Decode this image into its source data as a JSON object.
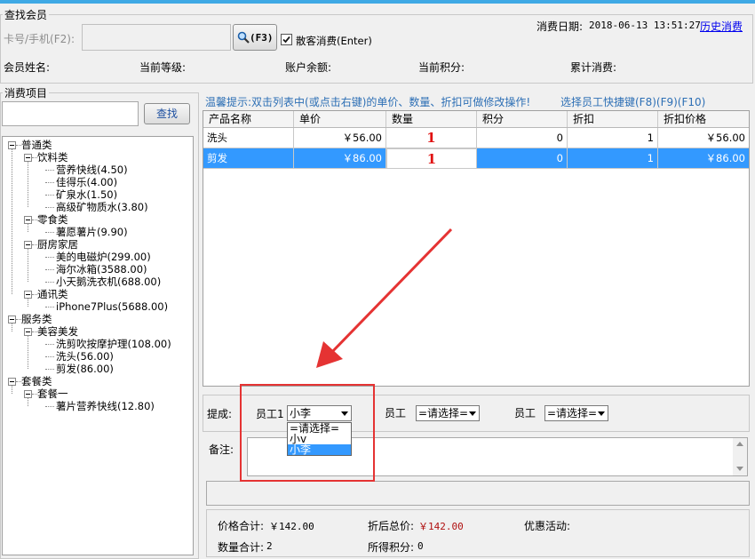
{
  "member_search": {
    "legend": "查找会员",
    "card_label": "卡号/手机(F2):",
    "card_value": "",
    "search_button": "(F3)",
    "walkin_label": "散客消费(Enter)",
    "walkin_checked": true,
    "date_label": "消费日期:",
    "date_value": "2018-06-13 13:51:27",
    "history_link": "历史消费",
    "name_label": "会员姓名:",
    "level_label": "当前等级:",
    "balance_label": "账户余额:",
    "points_label": "当前积分:",
    "total_label": "累计消费:"
  },
  "items_panel": {
    "legend": "消费项目",
    "search_value": "",
    "search_button": "查找"
  },
  "tree": [
    {
      "label": "普通类",
      "level": 0,
      "box": true
    },
    {
      "label": "饮料类",
      "level": 1,
      "box": true
    },
    {
      "label": "营养快线(4.50)",
      "level": 2
    },
    {
      "label": "佳得乐(4.00)",
      "level": 2
    },
    {
      "label": "矿泉水(1.50)",
      "level": 2
    },
    {
      "label": "高级矿物质水(3.80)",
      "level": 2
    },
    {
      "label": "零食类",
      "level": 1,
      "box": true
    },
    {
      "label": "薯愿薯片(9.90)",
      "level": 2
    },
    {
      "label": "厨房家居",
      "level": 1,
      "box": true
    },
    {
      "label": "美的电磁炉(299.00)",
      "level": 2
    },
    {
      "label": "海尔冰箱(3588.00)",
      "level": 2
    },
    {
      "label": "小天鹅洗衣机(688.00)",
      "level": 2
    },
    {
      "label": "通讯类",
      "level": 1,
      "box": true
    },
    {
      "label": "iPhone7Plus(5688.00)",
      "level": 2
    },
    {
      "label": "服务类",
      "level": 0,
      "box": true
    },
    {
      "label": "美容美发",
      "level": 1,
      "box": true
    },
    {
      "label": "洗剪吹按摩护理(108.00)",
      "level": 2
    },
    {
      "label": "洗头(56.00)",
      "level": 2
    },
    {
      "label": "剪发(86.00)",
      "level": 2
    },
    {
      "label": "套餐类",
      "level": 0,
      "box": true
    },
    {
      "label": "套餐一",
      "level": 1,
      "box": true
    },
    {
      "label": "薯片营养快线(12.80)",
      "level": 2
    }
  ],
  "hint": {
    "text": "温馨提示:双击列表中(或点击右键)的单价、数量、折扣可做修改操作!",
    "shortcut": "选择员工快捷键(F8)(F9)(F10)"
  },
  "table": {
    "columns": [
      "产品名称",
      "单价",
      "数量",
      "积分",
      "折扣",
      "折扣价格"
    ],
    "rows": [
      {
        "name": "洗头",
        "price": "￥56.00",
        "qty": "1",
        "points": "0",
        "discount": "1",
        "final": "￥56.00"
      },
      {
        "name": "剪发",
        "price": "￥86.00",
        "qty": "1",
        "points": "0",
        "discount": "1",
        "final": "￥86.00"
      }
    ]
  },
  "commission": {
    "label": "提成:",
    "staff1_label": "员工1",
    "staff1_value": "小李",
    "staff2_label": "员工",
    "staff2_value": "=请选择=",
    "staff3_label": "员工",
    "staff3_value": "=请选择=",
    "dropdown_options": [
      "=请选择=",
      "小v",
      "小李"
    ],
    "dropdown_selected": "小李"
  },
  "remarks": {
    "label": "备注:",
    "value": ""
  },
  "summary": {
    "price_total_label": "价格合计:",
    "price_total_value": "￥142.00",
    "discounted_label": "折后总价:",
    "discounted_value": "￥142.00",
    "promo_label": "优惠活动:",
    "qty_total_label": "数量合计:",
    "qty_total_value": "2",
    "points_label": "所得积分:",
    "points_value": "0"
  },
  "colors": {
    "selection": "#3399ff",
    "annotation": "#e53333",
    "quantity": "#e01010",
    "hint": "#2d6fb5",
    "price_discounted": "#b01010"
  }
}
